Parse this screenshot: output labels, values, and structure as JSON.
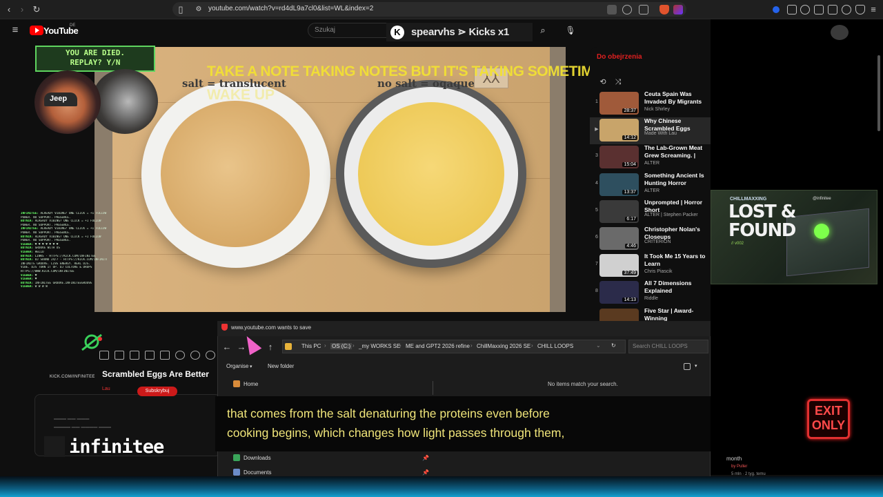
{
  "browser": {
    "url": "youtube.com/watch?v=rd4dL9a7cl0&list=WL&index=2"
  },
  "youtube": {
    "wordmark": "YouTube",
    "country": "DE",
    "search_placeholder": "Szukaj"
  },
  "kick_overlay": {
    "badge": "K",
    "title": "spearvhs ⋗ Kicks x1"
  },
  "overlay": {
    "died_text": "YOU ARE DIED.\nREPLAY? Y/N",
    "top_caption": "TAKE A NOTE TAKING NOTES BUT IT'S TAKING SOMETIMES WELL YOU",
    "faded_caption": "WAKE UP",
    "kick_link": "KICK.COM/INFINITEE",
    "brand_name": "infinitee",
    "hat_text": "Jeep"
  },
  "video": {
    "label_left": "salt = translucent",
    "label_right": "no salt = oqaque",
    "title": "Scrambled Eggs Are Better",
    "subscribe_label": "Subskrybuj",
    "channel_short": "Lau"
  },
  "chat": [
    {
      "user": "INFINITEE:",
      "msg": "ALREADY VIBING? ONE CLICK = +1 FOLLOW"
    },
    {
      "user": "",
      "msg": "POWER. NO SUPPORT. PRESENCE."
    },
    {
      "user": "BOTNIK:",
      "msg": "ALREADY VIBING? ONE CLICK = +1 FOLLOW"
    },
    {
      "user": "",
      "msg": "POWER. NO SUPPORT. PRESENCE."
    },
    {
      "user": "INFINITEE:",
      "msg": "ALREADY VIBING? ONE CLICK = +1 FOLLOW"
    },
    {
      "user": "",
      "msg": "POWER. NO SUPPORT. PRESENCE."
    },
    {
      "user": "BOTNIK:",
      "msg": "ALREADY VIBING? ONE CLICK = +1 FOLLOW"
    },
    {
      "user": "",
      "msg": "POWER. NO SUPPORT. PRESENCE."
    },
    {
      "user": "VIEWER:",
      "msg": "♥ ♥ ♥ ♥ ♥ ♥ ♥"
    },
    {
      "user": "BOTNIK:",
      "msg": "GROOVE WITH US"
    },
    {
      "user": "VIEWER:",
      "msg": "HELLO"
    },
    {
      "user": "BOTNIK:",
      "msg": "LINKS - HTTPS://KICK.COM/INFINITEE"
    },
    {
      "user": "BOTNIK:",
      "msg": "DJ SOUND 24/7 - HTTPS://KICK.COM/INFINITEE"
    },
    {
      "user": "",
      "msg": "INFINITE GROOVE. LIVE ENERGY. REAL DJS."
    },
    {
      "user": "",
      "msg": "VIBE. DJS TURN IT UP. DJ CULTURE & DROPS"
    },
    {
      "user": "",
      "msg": "HTTPS://WWW.KICK.COM/INFINITEE"
    },
    {
      "user": "VIEWER:",
      "msg": "♥"
    },
    {
      "user": "VIEWER:",
      "msg": "♥"
    },
    {
      "user": "BOTNIK:",
      "msg": "INFINITEE GROOVE.INFINITEEGROOVE"
    },
    {
      "user": "VIEWER:",
      "msg": "W W W W"
    }
  ],
  "playlist": {
    "header": "Do obejrzenia",
    "items": [
      {
        "num": "1",
        "title": "Ceuta Spain Was Invaded By Migrants",
        "channel": "Nick Shirley",
        "duration": "28:37",
        "color": "#a05a3a"
      },
      {
        "num": "▶",
        "title": "Why Chinese Scrambled Eggs",
        "channel": "Made With Lau",
        "duration": "14:12",
        "color": "#c8a46a"
      },
      {
        "num": "3",
        "title": "The Lab-Grown Meat Grew Screaming. | ALTER Horror",
        "channel": "ALTER",
        "duration": "15:04",
        "color": "#5a3030"
      },
      {
        "num": "4",
        "title": "Something Ancient Is Hunting Horror",
        "channel": "ALTER",
        "duration": "13:37",
        "color": "#2e4f5f"
      },
      {
        "num": "5",
        "title": "Unprompted | Horror Short",
        "channel": "ALTER | Stephen Packer",
        "duration": "6:17",
        "color": "#3a3a3a"
      },
      {
        "num": "6",
        "title": "Christopher Nolan's Closeups",
        "channel": "CRITERION",
        "duration": "4:46",
        "color": "#6a6a6a"
      },
      {
        "num": "7",
        "title": "It Took Me 15 Years to Learn",
        "channel": "Chris Piascik",
        "duration": "37:49",
        "color": "#d0d0d0"
      },
      {
        "num": "8",
        "title": "All 7 Dimensions Explained",
        "channel": "Riddle",
        "duration": "14:13",
        "color": "#2b2b4a"
      },
      {
        "num": "",
        "title": "Five Star | Award-Winning",
        "channel": "",
        "duration": "",
        "color": "#5a3a20"
      }
    ]
  },
  "right_panel": {
    "lost_found_small": "CHILLMAXXING",
    "lost_found_title": "LOST &\nFOUND",
    "lost_found_sub": "// v002",
    "lost_found_handle": "@infinitee",
    "exit_sign": "EXIT\nONLY",
    "frag_month": "month",
    "frag_channel": "by Puller",
    "frag_views": "5 mln · 2 tyg. temu"
  },
  "dialog": {
    "title": "www.youtube.com wants to save",
    "breadcrumbs": [
      "This PC",
      "OS (C:)",
      "_my WORKS SE",
      "ME and GPT2 2026 refine",
      "ChillMaxxing 2026 SE",
      "CHILL LOOPS"
    ],
    "search_placeholder": "Search CHILL LOOPS",
    "organise": "Organise",
    "new_folder": "New folder",
    "empty_message": "No items match your search.",
    "sidebar": [
      "Home",
      "Downloads",
      "Documents"
    ]
  },
  "subtitles": {
    "line1": "that comes from the salt denaturing the proteins even before",
    "line2": "cooking begins, which changes how light passes through them,"
  }
}
